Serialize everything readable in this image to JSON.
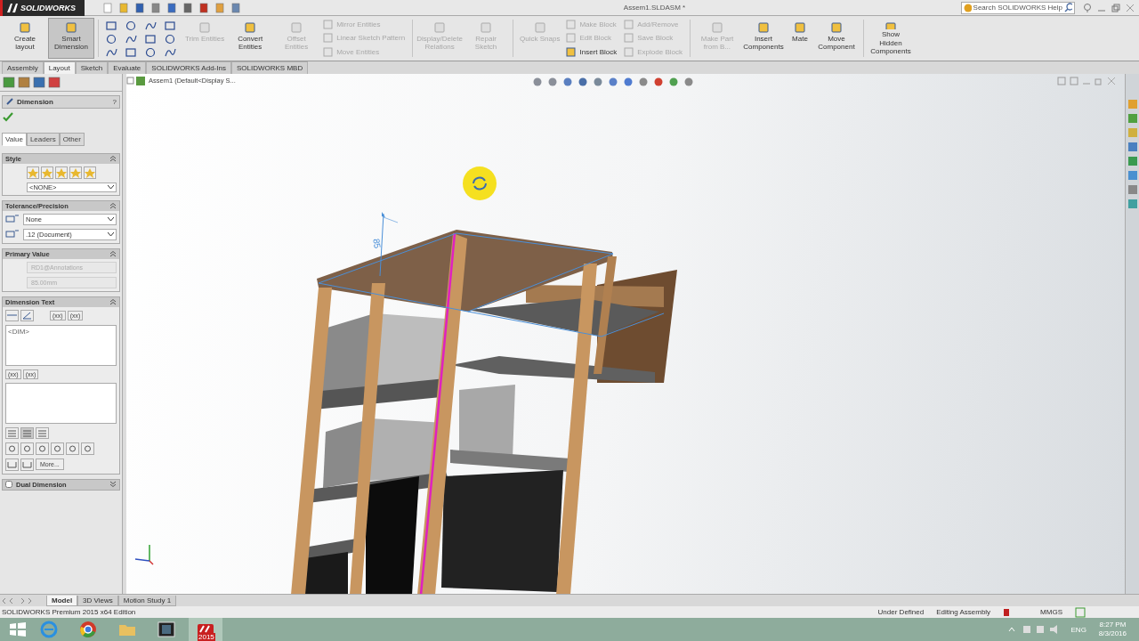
{
  "title_bar": {
    "app_name": "SOLIDWORKS",
    "document_title": "Assem1.SLDASM *",
    "search": {
      "placeholder": "Search SOLIDWORKS Help"
    }
  },
  "ribbon": [
    {
      "kind": "large",
      "label": "Create layout",
      "disabled": false,
      "selected": false
    },
    {
      "kind": "large",
      "label": "Smart Dimension",
      "disabled": false,
      "selected": true
    },
    {
      "kind": "sketch_tools"
    },
    {
      "kind": "large",
      "label": "Trim Entities",
      "disabled": true,
      "selected": false
    },
    {
      "kind": "large",
      "label": "Convert Entities",
      "disabled": false,
      "selected": false
    },
    {
      "kind": "large",
      "label": "Offset Entities",
      "disabled": true,
      "selected": false
    },
    {
      "kind": "stack",
      "items": [
        {
          "label": "Mirror Entities",
          "disabled": true
        },
        {
          "label": "Linear Sketch Pattern",
          "disabled": true
        },
        {
          "label": "Move Entities",
          "disabled": true
        }
      ]
    },
    {
      "kind": "large",
      "label": "Display/Delete Relations",
      "disabled": true,
      "selected": false
    },
    {
      "kind": "large",
      "label": "Repair Sketch",
      "disabled": true,
      "selected": false
    },
    {
      "kind": "large",
      "label": "Quick Snaps",
      "disabled": true,
      "selected": false
    },
    {
      "kind": "stack",
      "items": [
        {
          "label": "Make Block",
          "disabled": true
        },
        {
          "label": "Edit Block",
          "disabled": true
        },
        {
          "label": "Insert Block",
          "disabled": false
        }
      ]
    },
    {
      "kind": "stack",
      "items": [
        {
          "label": "Add/Remove",
          "disabled": true
        },
        {
          "label": "Save Block",
          "disabled": true
        },
        {
          "label": "Explode Block",
          "disabled": true
        }
      ]
    },
    {
      "kind": "large",
      "label": "Make Part from B...",
      "disabled": true,
      "selected": false
    },
    {
      "kind": "large",
      "label": "Insert Components",
      "disabled": false,
      "selected": false
    },
    {
      "kind": "large",
      "label": "Mate",
      "disabled": false,
      "selected": false
    },
    {
      "kind": "large",
      "label": "Move Component",
      "disabled": false,
      "selected": false
    },
    {
      "kind": "large",
      "label": "Show Hidden Components",
      "disabled": false,
      "selected": false
    }
  ],
  "tabs": [
    {
      "label": "Assembly",
      "selected": false
    },
    {
      "label": "Layout",
      "selected": true
    },
    {
      "label": "Sketch",
      "selected": false
    },
    {
      "label": "Evaluate",
      "selected": false
    },
    {
      "label": "SOLIDWORKS Add-Ins",
      "selected": false
    },
    {
      "label": "SOLIDWORKS MBD",
      "selected": false
    }
  ],
  "property_manager": {
    "title": "Dimension",
    "help": "?",
    "tabs": [
      {
        "label": "Value",
        "selected": true
      },
      {
        "label": "Leaders",
        "selected": false
      },
      {
        "label": "Other",
        "selected": false
      }
    ],
    "sections": [
      {
        "kind": "style",
        "title": "Style",
        "dropdown": "<NONE>"
      },
      {
        "kind": "tolerance",
        "title": "Tolerance/Precision",
        "dropdowns": [
          "None",
          ".12 (Document)"
        ]
      },
      {
        "kind": "primary",
        "title": "Primary Value",
        "fields": [
          "RD1@Annotations",
          "85.00mm"
        ]
      },
      {
        "kind": "dimtext",
        "title": "Dimension Text",
        "text": "<DIM>",
        "tags": [
          "(xx)",
          "(xx)"
        ],
        "tags_lower": [
          "(xx)",
          "(xx)"
        ],
        "more": "More..."
      },
      {
        "kind": "dual",
        "title": "Dual Dimension",
        "checked": false
      }
    ]
  },
  "viewport": {
    "tree_root": "Assem1  (Default<Display S...",
    "dimension_label": "85"
  },
  "bottom_tabs": [
    {
      "label": "Model",
      "selected": true
    },
    {
      "label": "3D Views",
      "selected": false
    },
    {
      "label": "Motion Study 1",
      "selected": false
    }
  ],
  "status_bar": {
    "edition": "SOLIDWORKS Premium 2015 x64 Edition",
    "state": "Under Defined",
    "mode": "Editing Assembly",
    "units": "MMGS"
  },
  "taskbar": {
    "apps": [
      {
        "kind": "ie",
        "selected": false
      },
      {
        "kind": "chrome",
        "selected": false
      },
      {
        "kind": "explorer",
        "selected": false
      },
      {
        "kind": "media",
        "selected": false
      },
      {
        "kind": "solidworks",
        "badge": "2015",
        "selected": true
      }
    ],
    "language": "ENG",
    "time": "8:27 PM",
    "date": "8/3/2016"
  }
}
